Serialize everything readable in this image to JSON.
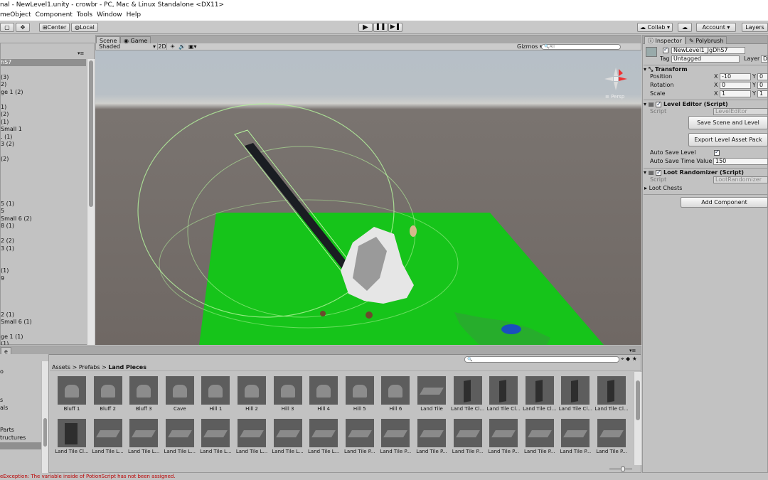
{
  "window": {
    "title": "nal - NewLevel1.unity - crowbr - PC, Mac & Linux Standalone <DX11>"
  },
  "menu": [
    "meObject",
    "Component",
    "Tools",
    "Window",
    "Help"
  ],
  "toolbar": {
    "center_label": "Center",
    "local_label": "Local",
    "collab_label": "Collab ▾",
    "account_label": "Account ▾",
    "layers_label": "Layers"
  },
  "hierarchy": {
    "header": "hS7",
    "items": [
      "(3)",
      "2)",
      "ge 1 (2)",
      "1)",
      "(2)",
      "(1)",
      "Small 1",
      ". (1)",
      "3 (2)",
      "(2)",
      "5 (1)",
      "5",
      "Small 6 (2)",
      "8 (1)",
      "2 (2)",
      "3 (1)",
      "(1)",
      "9",
      "2 (1)",
      "Small 6 (1)",
      "ge 1 (1)",
      "(1)"
    ]
  },
  "scene": {
    "tabs": {
      "scene": "Scene",
      "game": "Game"
    },
    "shading_mode": "Shaded",
    "mode_2d": "2D",
    "gizmos_label": "Gizmos ▾",
    "search_placeholder": "All",
    "persp_label": "≡ Persp"
  },
  "inspector": {
    "tabs": {
      "inspector": "Inspector",
      "polybrush": "Polybrush"
    },
    "object_name": "NewLevel1_JgDhS7",
    "tag_label": "Tag",
    "tag_value": "Untagged",
    "layer_label": "Layer",
    "layer_value": "D",
    "transform": {
      "title": "Transform",
      "position_label": "Position",
      "rotation_label": "Rotation",
      "scale_label": "Scale",
      "position": {
        "x": "-10",
        "y": "0"
      },
      "rotation": {
        "x": "0",
        "y": "0"
      },
      "scale": {
        "x": "1",
        "y": "1"
      }
    },
    "level_editor": {
      "title": "Level Editor (Script)",
      "script_label": "Script",
      "script_value": "LevelEditor",
      "save_button": "Save Scene and Level",
      "export_button": "Export Level Asset Pack",
      "auto_save_label": "Auto Save Level",
      "auto_save_time_label": "Auto Save Time Value",
      "auto_save_time_value": "150"
    },
    "loot_randomizer": {
      "title": "Loot Randomizer (Script)",
      "script_label": "Script",
      "script_value": "LootRandomizer",
      "loot_chests_label": "Loot Chests"
    },
    "add_component": "Add Component"
  },
  "project": {
    "tab": "e",
    "left_items": [
      "o",
      "s",
      "als",
      "Parts",
      "tructures"
    ],
    "breadcrumb": [
      "Assets",
      "Prefabs",
      "Land Pieces"
    ],
    "assets_row1": [
      "Bluff 1",
      "Bluff 2",
      "Bluff 3",
      "Cave",
      "Hill 1",
      "Hill 2",
      "Hill 3",
      "Hill 4",
      "Hill 5",
      "Hill 6",
      "Land Tile",
      "Land Tile Cl...",
      "Land Tile Cl...",
      "Land Tile Cl...",
      "Land Tile Cl...",
      "Land Tile Cl..."
    ],
    "assets_row2": [
      "Land Tile Cl...",
      "Land Tile L...",
      "Land Tile L...",
      "Land Tile L...",
      "Land Tile L...",
      "Land Tile L...",
      "Land Tile L...",
      "Land Tile L...",
      "Land Tile P...",
      "Land Tile P...",
      "Land Tile P...",
      "Land Tile P...",
      "Land Tile P...",
      "Land Tile P...",
      "Land Tile P...",
      "Land Tile P..."
    ]
  },
  "status": {
    "message": "eException: The variable inside of PotionScript has not been assigned."
  }
}
